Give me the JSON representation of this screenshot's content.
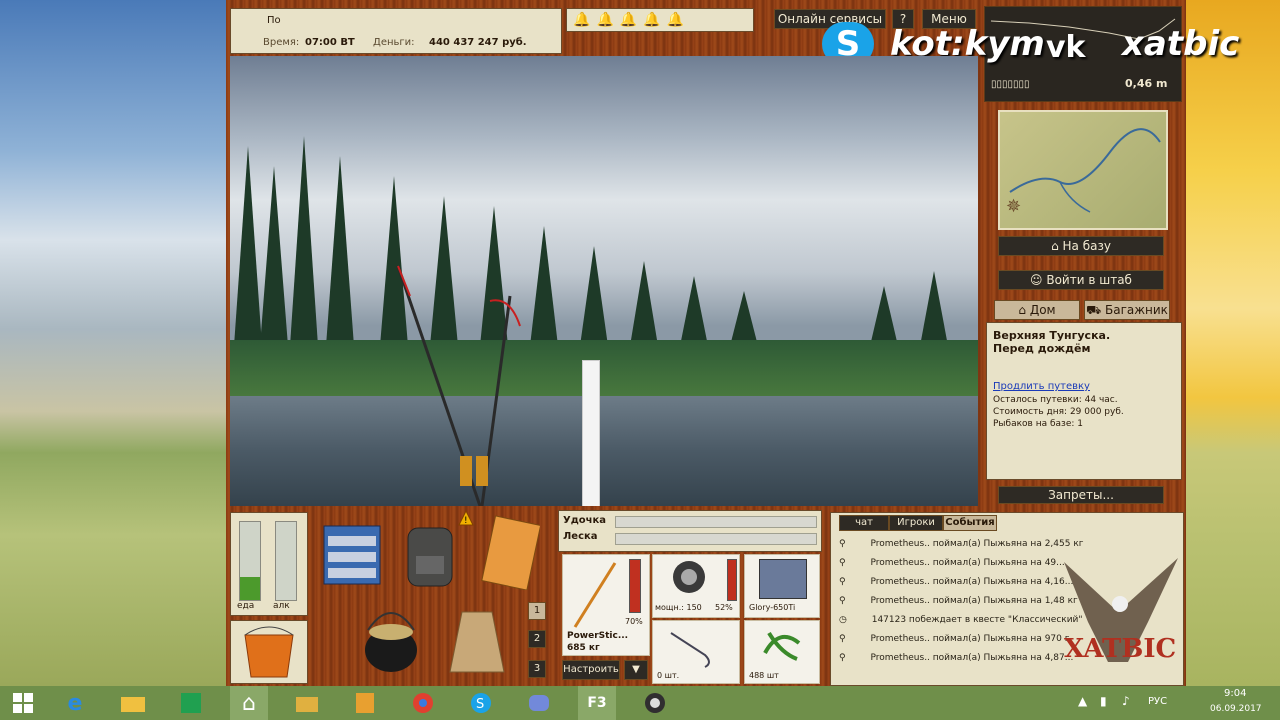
{
  "top_bar": {
    "day_label": "По",
    "time_label": "Время:",
    "time_value": "07:00 ВТ",
    "money_label": "Деньги:",
    "money_value": "440 437 247 руб.",
    "online_services": "Онлайн сервисы",
    "help": "?",
    "menu": "Меню"
  },
  "depth_gauge": {
    "value": "0,46 m"
  },
  "watermark": {
    "left": "kot:kym",
    "right": "xatbic"
  },
  "right_panel": {
    "to_base": "На базу",
    "to_hq": "Войти в штаб",
    "home": "Дом",
    "trunk": "Багажник",
    "location_title": "Верхняя Тунгуска. Перед дождём",
    "extend_link": "Продлить путевку",
    "remaining": "Осталось путевки: 44 час.",
    "cost": "Стоимость дня: 29 000 руб.",
    "fishers": "Рыбаков на базе: 1",
    "bans": "Запреты..."
  },
  "bottom_left": {
    "food_label": "еда",
    "alc_label": "алк",
    "food_level": 0.3,
    "alc_level": 0.0,
    "slots": [
      "1",
      "2",
      "3"
    ]
  },
  "rod_panel": {
    "catch_label": "Удочка",
    "line_label": "Леска",
    "rod_name": "PowerStic...",
    "rod_load": "685 кг",
    "rod_pct": "70%",
    "reel_power_label": "мощн.: 150",
    "reel_pct": "52%",
    "line_name": "Glory-650Ti",
    "lure_count": "0 шт.",
    "bait_count": "488 шт",
    "setup_button": "Настроить",
    "dropdown_arrow": "▼"
  },
  "events": {
    "tabs": [
      "чат",
      "Игроки",
      "События"
    ],
    "active_tab": "События",
    "rows": [
      "Prometheus.. поймал(а) Пыжьяна на 2,455 кг",
      "Prometheus.. поймал(а) Пыжьяна на 49...",
      "Prometheus.. поймал(а) Пыжьяна на 4,16...",
      "Prometheus.. поймал(а) Пыжьяна на 1,48 кг",
      "147123 побеждает в квесте \"Классический\"",
      "Prometheus.. поймал(а) Пыжьяна на 970 г",
      "Prometheus.. поймал(а) Пыжьяна на 4,87..."
    ]
  },
  "brand_logo": "XATBIC",
  "taskbar": {
    "language": "РУС",
    "time": "9:04",
    "date": "06.09.2017",
    "colors": {
      "bg": "#6f8f4a",
      "active": "#8aa868"
    }
  }
}
